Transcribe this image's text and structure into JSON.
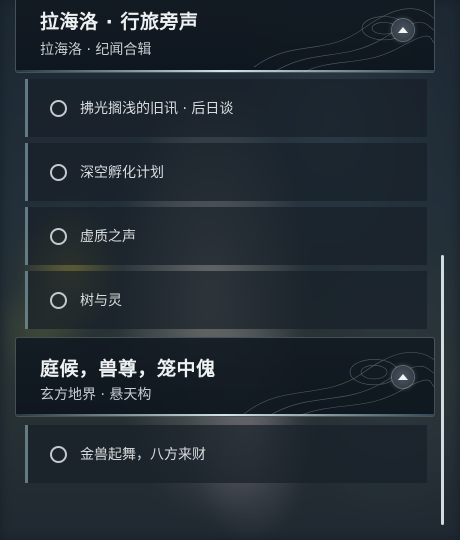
{
  "groups": [
    {
      "title": "拉海洛 · 行旅旁声",
      "subtitle": "拉海洛 · 纪闻合辑",
      "expanded": true,
      "items": [
        {
          "label": "拂光搁浅的旧讯 · 后日谈"
        },
        {
          "label": "深空孵化计划"
        },
        {
          "label": "虚质之声"
        },
        {
          "label": "树与灵"
        }
      ]
    },
    {
      "title": "庭候，兽尊，笼中傀",
      "subtitle": "玄方地界 · 悬天构",
      "expanded": true,
      "items": [
        {
          "label": "金兽起舞，八方来财"
        }
      ]
    }
  ],
  "icons": {
    "collapse": "chevron-up-icon",
    "item_status": "radio-unchecked-icon"
  },
  "colors": {
    "header_bg": "#121a22",
    "accent_line": "#dcf0f5",
    "text_primary": "#eef1f2",
    "text_secondary": "#c7ced1"
  }
}
